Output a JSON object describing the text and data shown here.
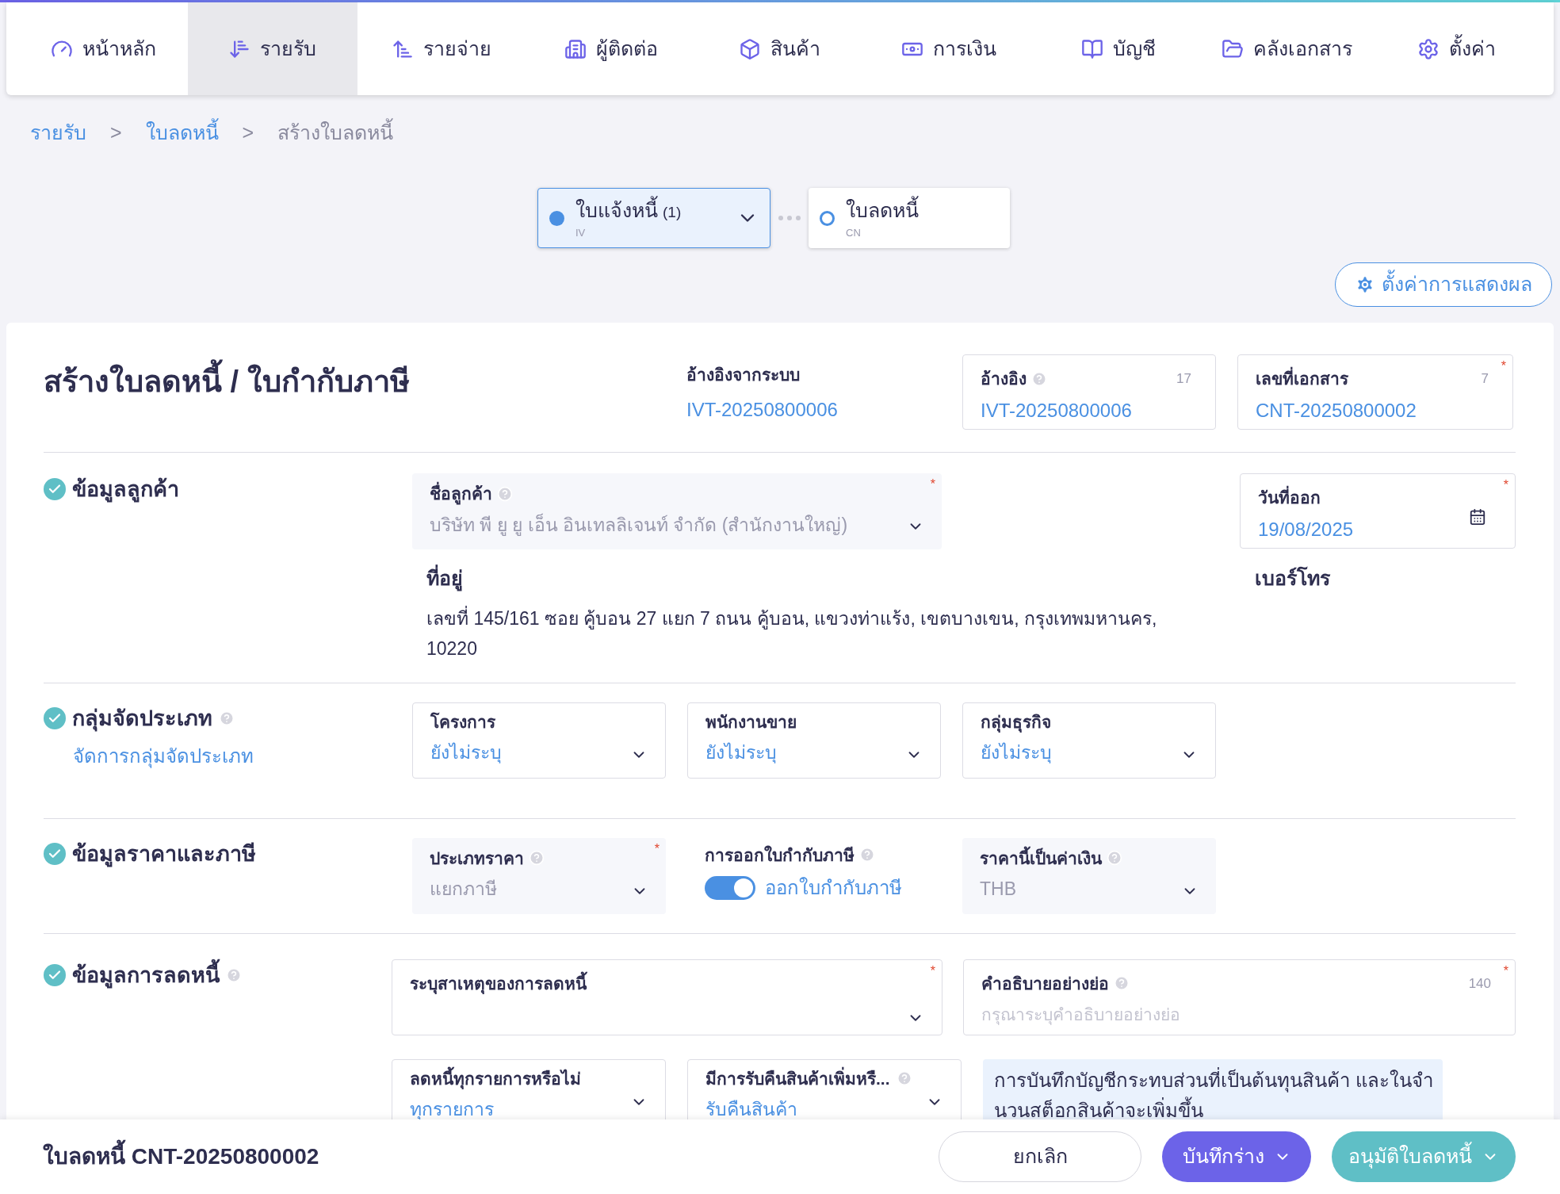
{
  "nav": {
    "items": [
      {
        "label": "หน้าหลัก",
        "selected": false
      },
      {
        "label": "รายรับ",
        "selected": true
      },
      {
        "label": "รายจ่าย",
        "selected": false
      },
      {
        "label": "ผู้ติดต่อ",
        "selected": false
      },
      {
        "label": "สินค้า",
        "selected": false
      },
      {
        "label": "การเงิน",
        "selected": false
      },
      {
        "label": "บัญชี",
        "selected": false
      },
      {
        "label": "คลังเอกสาร",
        "selected": false
      },
      {
        "label": "ตั้งค่า",
        "selected": false
      }
    ]
  },
  "breadcrumb": [
    {
      "label": "รายรับ",
      "kind": "link"
    },
    {
      "label": ">",
      "kind": "separator"
    },
    {
      "label": "ใบลดหนี้",
      "kind": "link"
    },
    {
      "label": ">",
      "kind": "separator"
    },
    {
      "label": "สร้างใบลดหนี้",
      "kind": "current"
    }
  ],
  "stepper": {
    "steps": [
      {
        "label": "ใบแจ้งหนี้",
        "count": "(1)",
        "code": "IV",
        "selected": true,
        "expandable": true
      },
      {
        "label": "ใบลดหนี้",
        "code": "CN",
        "selected": false
      }
    ]
  },
  "display_settings_button": "ตั้งค่าการแสดงผล",
  "form": {
    "title": "สร้างใบลดหนี้ / ใบกำกับภาษี",
    "system_ref": {
      "label": "อ้างอิงจากระบบ",
      "value": "IVT-20250800006"
    },
    "header_fields": [
      {
        "label": "อ้างอิง",
        "help": true,
        "counter": "17",
        "value": "IVT-20250800006"
      },
      {
        "label": "เลขที่เอกสาร",
        "counter": "7",
        "required_mark": "*",
        "value": "CNT-20250800002"
      }
    ],
    "customer": {
      "title": "ข้อมูลลูกค้า",
      "done": true,
      "name_field": {
        "label": "ชื่อลูกค้า",
        "help": true,
        "required_mark": "*",
        "disabled": true,
        "value": "บริษัท พี ยู ยู เอ็น อินเทลลิเจนท์ จำกัด (สำนักงานใหญ่)"
      },
      "date_field": {
        "label": "วันที่ออก",
        "required_mark": "*",
        "value": "19/08/2025"
      },
      "address_label": "ที่อยู่",
      "address": "เลขที่ 145/161 ซอย คู้บอน 27 แยก 7 ถนน คู้บอน, แขวงท่าแร้ง, เขตบางเขน, กรุงเทพมหานคร, 10220",
      "phone_label": "เบอร์โทร"
    },
    "grouping": {
      "title": "กลุ่มจัดประเภท",
      "done": true,
      "help": true,
      "link": "จัดการกลุ่มจัดประเภท",
      "fields": [
        {
          "label": "โครงการ",
          "value": "ยังไม่ระบุ",
          "disabled": false
        },
        {
          "label": "พนักงานขาย",
          "value": "ยังไม่ระบุ",
          "disabled": false
        },
        {
          "label": "กลุ่มธุรกิจ",
          "value": "ยังไม่ระบุ",
          "disabled": false
        }
      ]
    },
    "pricing": {
      "title": "ข้อมูลราคาและภาษี",
      "done": true,
      "fields": [
        {
          "kind": "select",
          "label": "ประเภทราคา",
          "help": true,
          "required_mark": "*",
          "disabled": true,
          "value": "แยกภาษี"
        },
        {
          "kind": "toggle",
          "label": "การออกใบกำกับภาษี",
          "help": true,
          "on": true,
          "value": "ออกใบกำกับภาษี"
        },
        {
          "kind": "select",
          "label": "ราคานี้เป็นค่าเงิน",
          "help": true,
          "disabled": true,
          "value": "THB"
        }
      ]
    },
    "credit": {
      "title": "ข้อมูลการลดหนี้",
      "done": true,
      "help": true,
      "reason": {
        "label": "ระบุสาเหตุของการลดหนี้",
        "required_mark": "*"
      },
      "description": {
        "label": "คำอธิบายอย่างย่อ",
        "help": true,
        "counter": "140",
        "required_mark": "*",
        "placeholder": "กรุณาระบุคำอธิบายอย่างย่อ"
      },
      "options": [
        {
          "label": "ลดหนี้ทุกรายการหรือไม่",
          "value": "ทุกรายการ"
        },
        {
          "label": "มีการรับคืนสินค้าเพิ่มหรื...",
          "help": true,
          "value": "รับคืนสินค้า"
        }
      ],
      "note_lines": [
        "การบันทึกบัญชีกระทบส่วนที่เป็นต้นทุนสินค้า และในจำ",
        "นวนสต็อกสินค้าจะเพิ่มขึ้น"
      ]
    }
  },
  "footer": {
    "title": "ใบลดหนี้ CNT-20250800002",
    "buttons": [
      {
        "label": "ยกเลิก",
        "kind": "outline"
      },
      {
        "label": "บันทึกร่าง",
        "kind": "primary"
      },
      {
        "label": "อนุมัติใบลดหนี้",
        "kind": "success"
      }
    ]
  }
}
